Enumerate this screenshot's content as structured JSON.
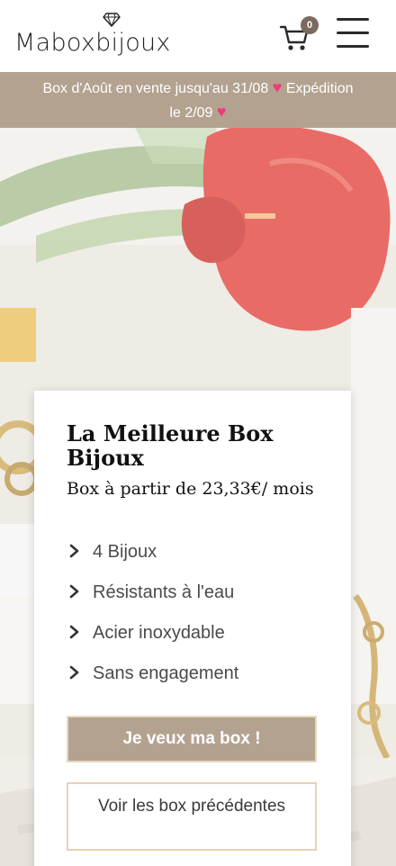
{
  "header": {
    "logo_text": "Maboxbijoux",
    "cart_count": "0"
  },
  "announcement": {
    "line1": "Box d'Août en vente jusqu'au 31/08",
    "line1_after": "Expédition",
    "line2": "le 2/09",
    "heart": "♥"
  },
  "card": {
    "title": "La Meilleure Box Bijoux",
    "subtitle": "Box à partir de 23,33€/ mois",
    "features": [
      "4 Bijoux",
      "Résistants à l'eau",
      "Acier inoxydable",
      "Sans engagement"
    ],
    "primary_button": "Je veux ma box !",
    "secondary_button": "Voir les box précédentes"
  },
  "icons": {
    "logo": "diamond-icon",
    "cart": "cart-icon",
    "menu": "hamburger-menu-icon",
    "feature_bullet": "chevron-right-icon"
  },
  "colors": {
    "accent": "#b4a291",
    "heart": "#ec3d7a",
    "button_border": "#e6d2b5",
    "badge": "#7b6a5e"
  }
}
